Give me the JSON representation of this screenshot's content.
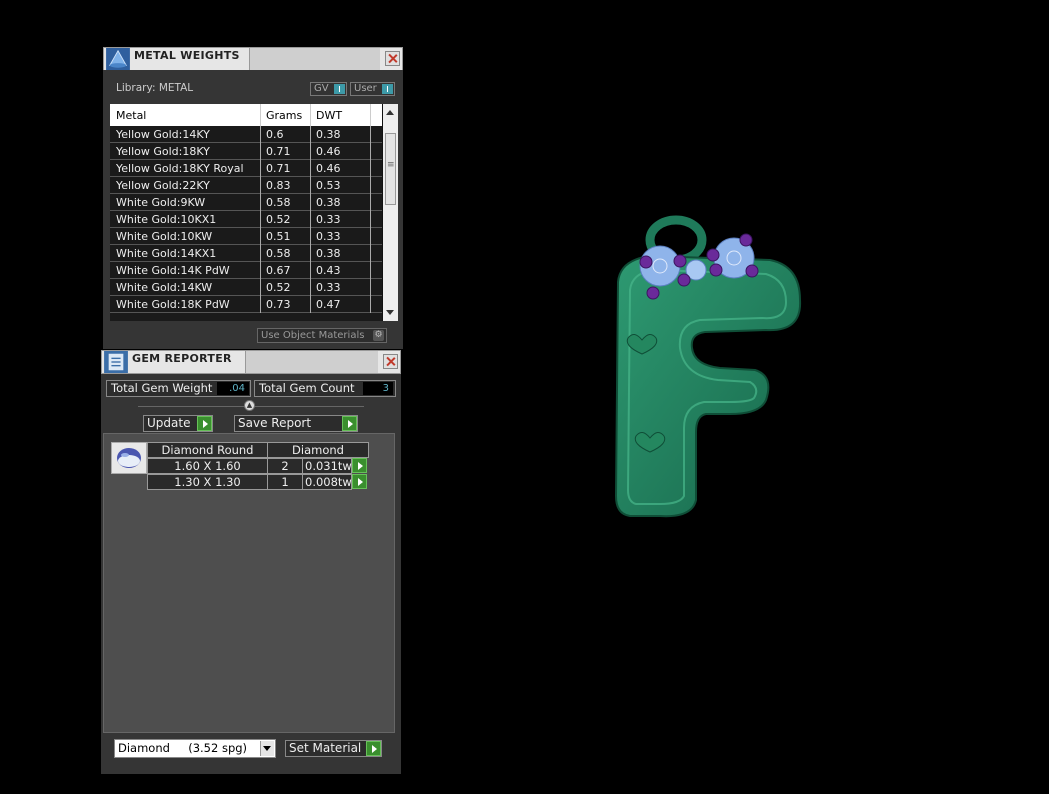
{
  "metal_weights": {
    "title": "METAL WEIGHTS",
    "library_label": "Library: METAL",
    "toggle_gv": "GV",
    "toggle_user": "User",
    "columns": [
      "Metal",
      "Grams",
      "DWT"
    ],
    "rows": [
      [
        "Yellow Gold:14KY",
        "0.6",
        "0.38"
      ],
      [
        "Yellow Gold:18KY",
        "0.71",
        "0.46"
      ],
      [
        "Yellow Gold:18KY Royal",
        "0.71",
        "0.46"
      ],
      [
        "Yellow Gold:22KY",
        "0.83",
        "0.53"
      ],
      [
        "White Gold:9KW",
        "0.58",
        "0.38"
      ],
      [
        "White Gold:10KX1",
        "0.52",
        "0.33"
      ],
      [
        "White Gold:10KW",
        "0.51",
        "0.33"
      ],
      [
        "White Gold:14KX1",
        "0.58",
        "0.38"
      ],
      [
        "White Gold:14K PdW",
        "0.67",
        "0.43"
      ],
      [
        "White Gold:14KW",
        "0.52",
        "0.33"
      ],
      [
        "White Gold:18K PdW",
        "0.73",
        "0.47"
      ]
    ],
    "use_object_materials": "Use Object Materials"
  },
  "gem_reporter": {
    "title": "GEM REPORTER",
    "total_weight_label": "Total Gem Weight",
    "total_weight_value": ".04",
    "total_count_label": "Total Gem Count",
    "total_count_value": "3",
    "update_label": "Update",
    "save_report_label": "Save Report",
    "table_header_shape": "Diamond Round",
    "table_header_material": "Diamond",
    "gems": [
      {
        "size": "1.60 X 1.60",
        "count": "2",
        "weight": "0.031tw"
      },
      {
        "size": "1.30 X 1.30",
        "count": "1",
        "weight": "0.008tw"
      }
    ],
    "material_select": "Diamond     (3.52 spg)",
    "set_material_label": "Set Material"
  },
  "colors": {
    "pendant_green": "#1f7a5a",
    "gem_blue": "#8fb4ea",
    "gem_purple": "#6a2a9a",
    "go_button_green": "#3a8f2e"
  }
}
